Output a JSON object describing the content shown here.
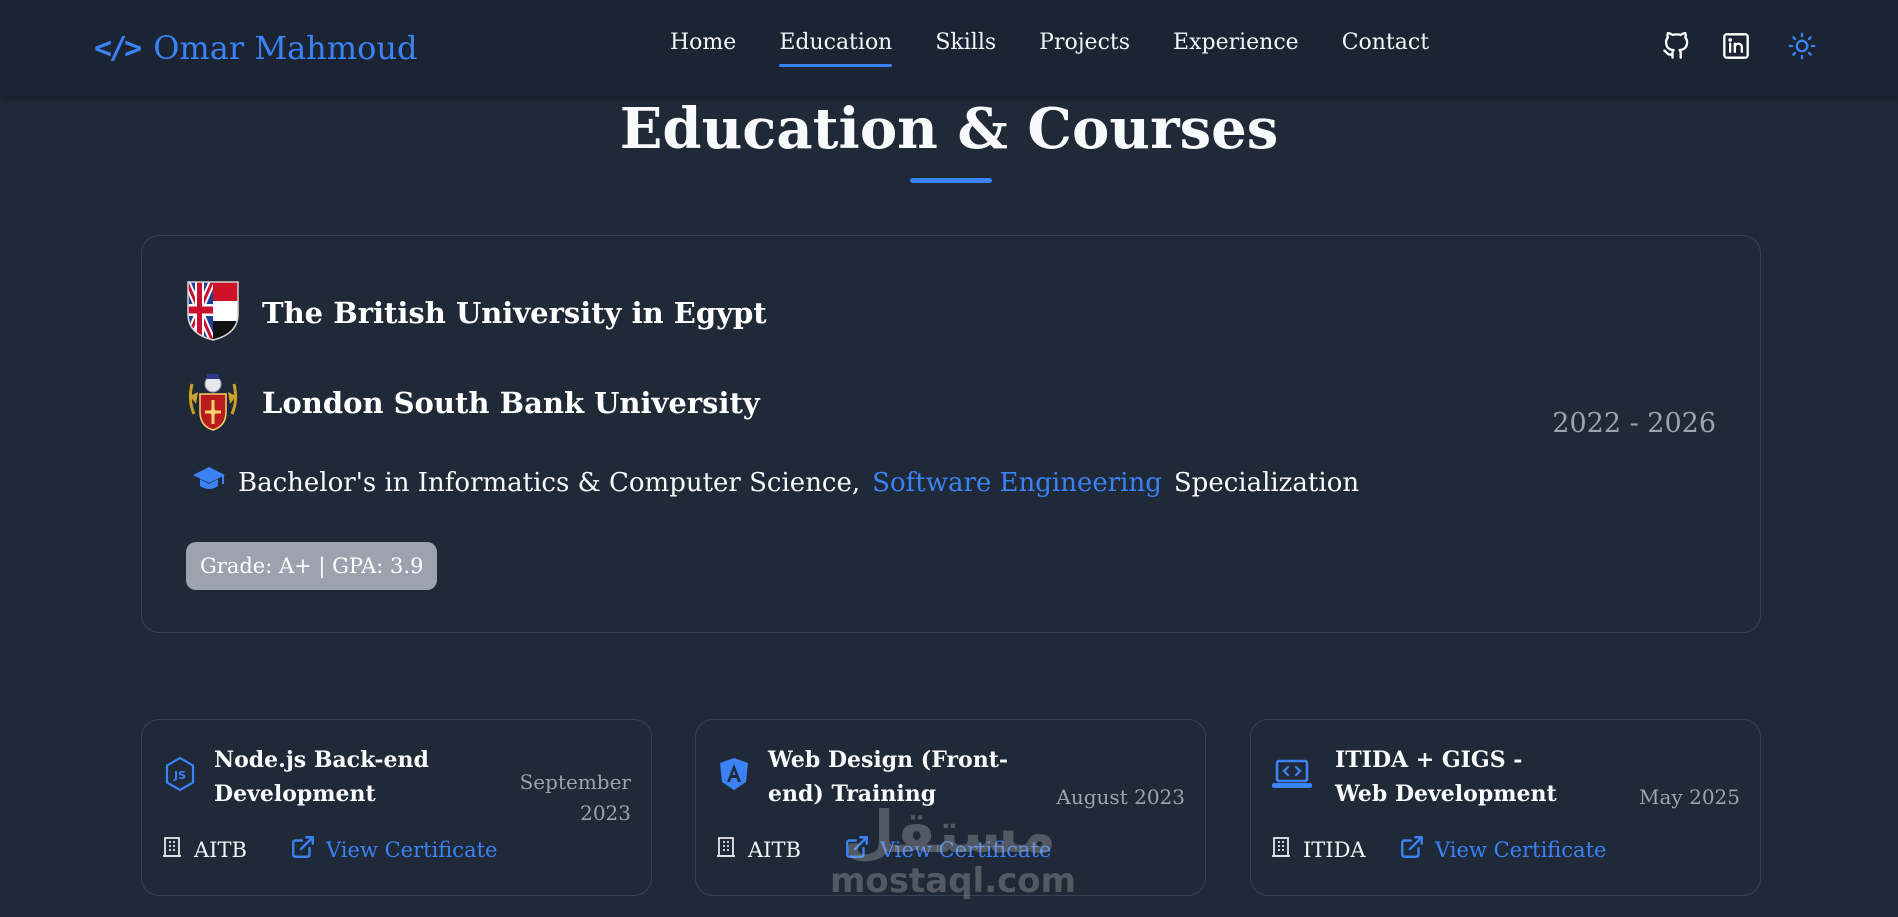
{
  "brand": {
    "icon_glyph": "</>",
    "name": "Omar Mahmoud",
    "color": "#3b82f6"
  },
  "nav": {
    "items": [
      {
        "label": "Home",
        "active": false
      },
      {
        "label": "Education",
        "active": true
      },
      {
        "label": "Skills",
        "active": false
      },
      {
        "label": "Projects",
        "active": false
      },
      {
        "label": "Experience",
        "active": false
      },
      {
        "label": "Contact",
        "active": false
      }
    ],
    "icons": [
      "github-icon",
      "linkedin-icon",
      "sun-icon"
    ]
  },
  "section": {
    "title": "Education & Courses"
  },
  "education": {
    "universities": [
      {
        "name": "The British University in Egypt",
        "logo": "bue-crest-icon"
      },
      {
        "name": "London South Bank University",
        "logo": "lsbu-crest-icon"
      }
    ],
    "years": "2022 - 2026",
    "degree_prefix": "Bachelor's in Informatics & Computer Science,",
    "degree_highlight": "Software Engineering",
    "degree_suffix": "Specialization",
    "grade": "Grade: A+ | GPA: 3.9"
  },
  "courses": [
    {
      "icon": "nodejs-icon",
      "title": "Node.js Back-end Development",
      "date": "September 2023",
      "org": "AITB",
      "link_label": "View Certificate"
    },
    {
      "icon": "angular-icon",
      "title": "Web Design (Front-end) Training",
      "date": "August 2023",
      "org": "AITB",
      "link_label": "View Certificate"
    },
    {
      "icon": "laptop-code-icon",
      "title": "ITIDA + GIGS - Web Development",
      "date": "May 2025",
      "org": "ITIDA",
      "link_label": "View Certificate"
    }
  ],
  "watermark": {
    "arabic": "مستقل",
    "latin": "mostaql.com"
  },
  "colors": {
    "background": "#1f2937",
    "accent": "#3b82f6",
    "muted": "#9ca3af"
  }
}
